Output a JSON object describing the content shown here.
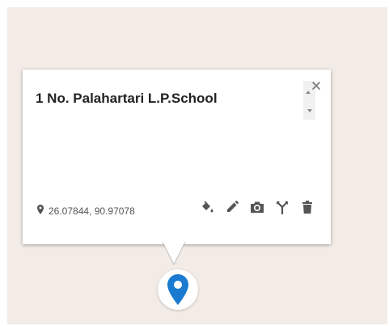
{
  "popup": {
    "title": "1 No. Palahartari L.P.School",
    "coordinates": "26.07844, 90.97078",
    "close_icon": "close-icon",
    "tools": [
      {
        "name": "fill-style",
        "icon": "paint-bucket-icon"
      },
      {
        "name": "edit",
        "icon": "pencil-icon"
      },
      {
        "name": "add-photo",
        "icon": "camera-icon"
      },
      {
        "name": "directions",
        "icon": "directions-icon"
      },
      {
        "name": "delete",
        "icon": "trash-icon"
      }
    ]
  },
  "marker": {
    "icon": "map-pin-icon",
    "color": "#1a7bd0"
  },
  "colors": {
    "map_background": "#f3ebe6",
    "popup_background": "#ffffff",
    "icon_gray": "#555555"
  }
}
